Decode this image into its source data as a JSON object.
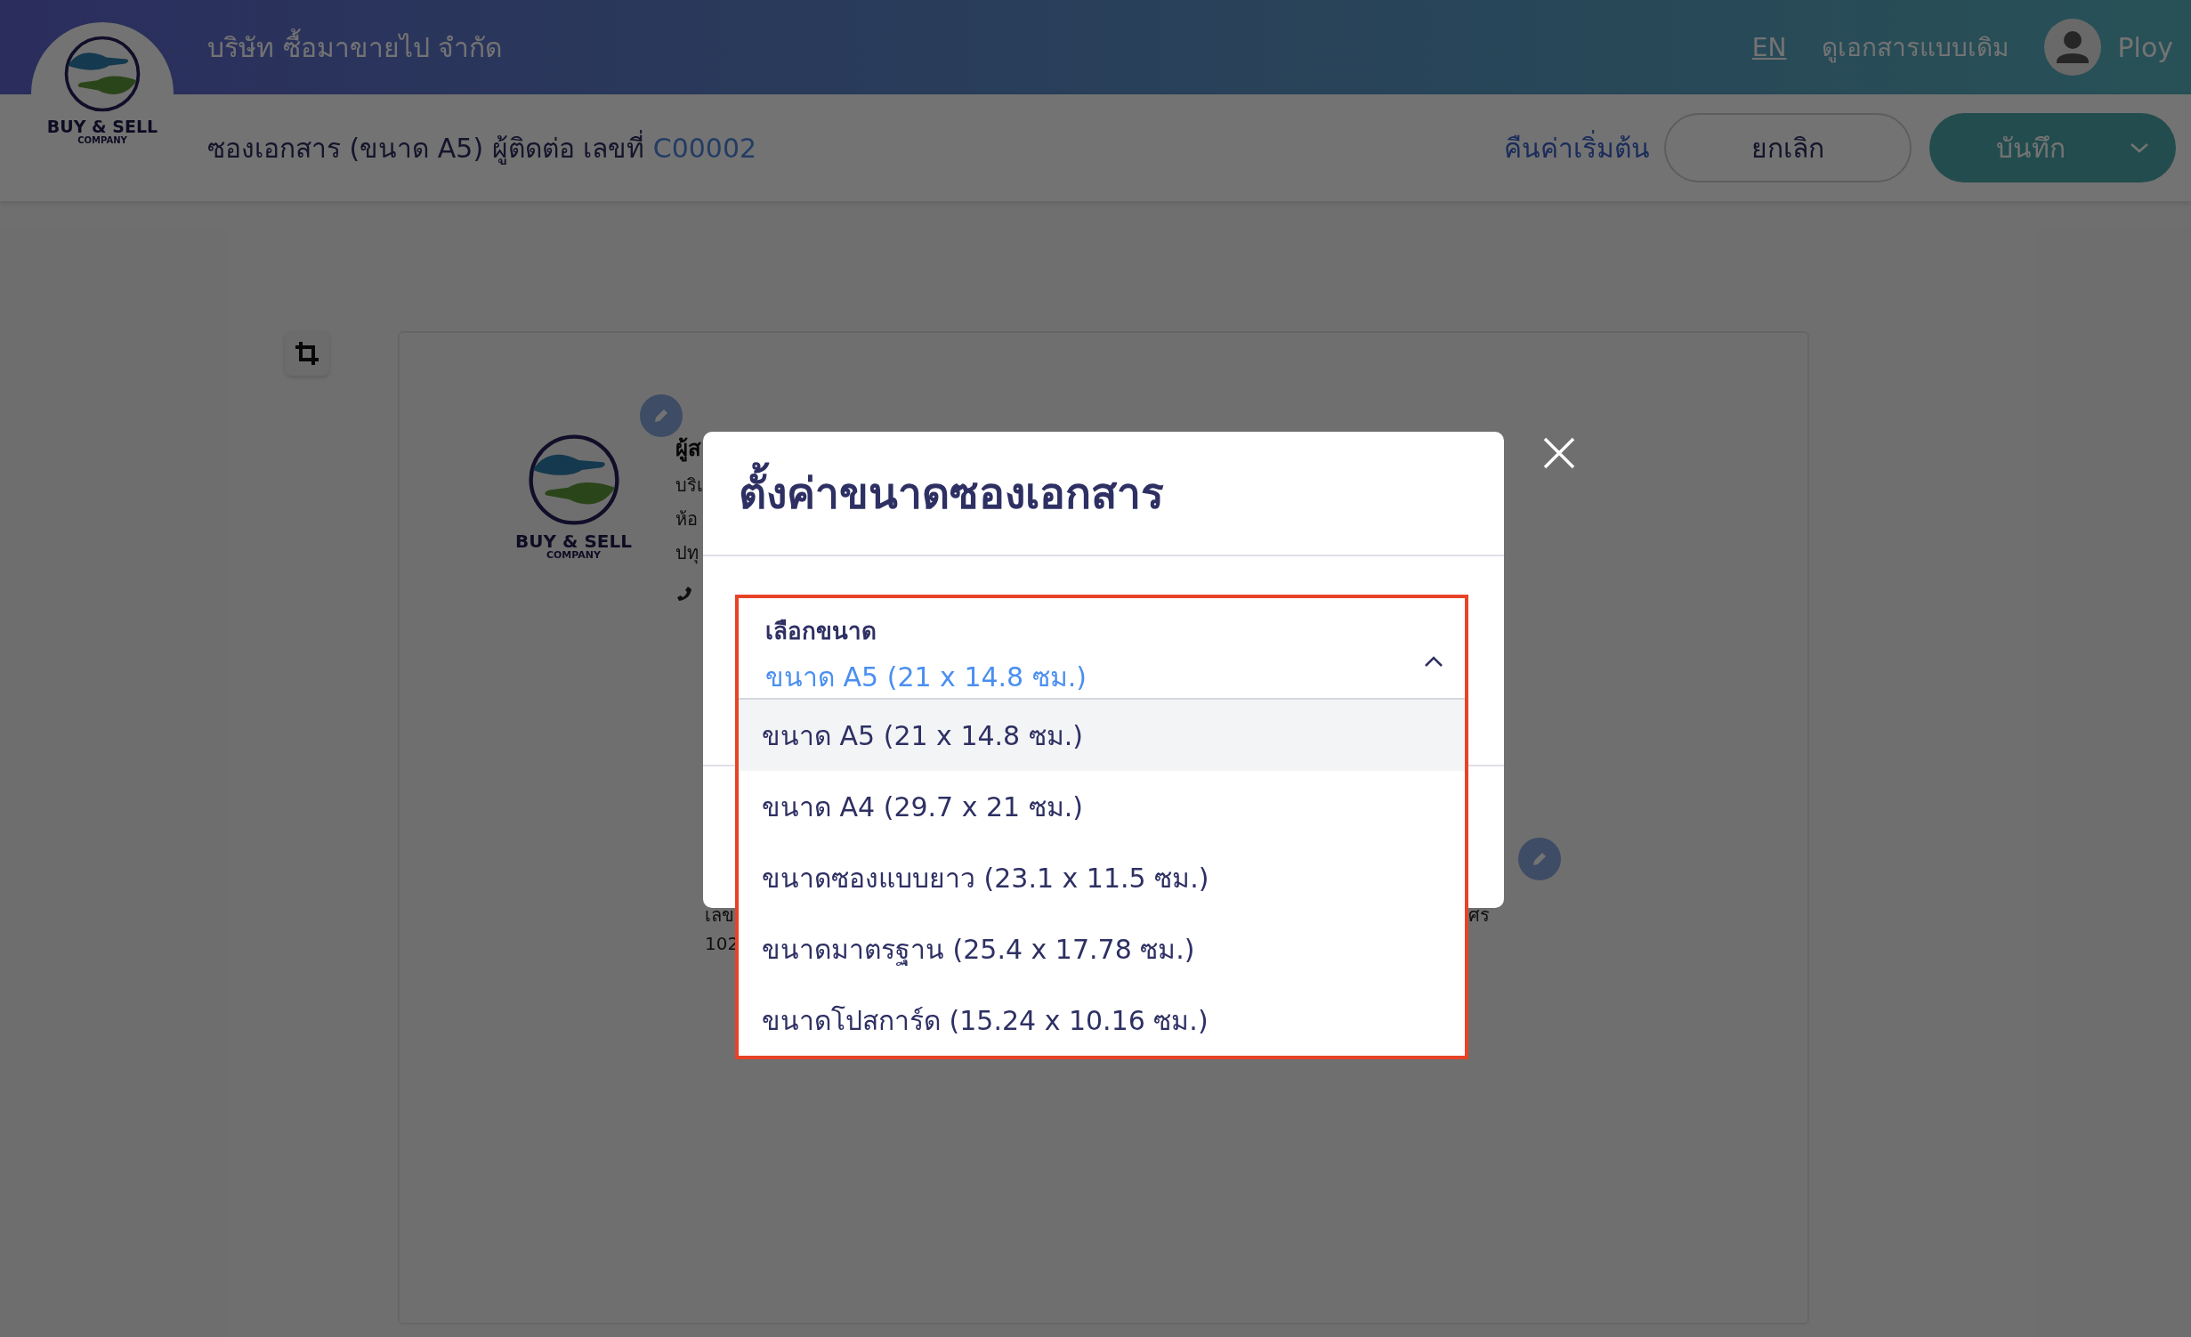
{
  "header": {
    "logo_name": "BUY & SELL",
    "logo_sub": "COMPANY",
    "company": "บริษัท ซื้อมาขายไป จำกัด",
    "language": "EN",
    "classic_view": "ดูเอกสารแบบเดิม",
    "user": "Ploy"
  },
  "toolbar": {
    "title": "ซองเอกสาร (ขนาด A5) ผู้ติดต่อ เลขที่",
    "doc_number": "C00002",
    "reset": "คืนค่าเริ่มต้น",
    "cancel": "ยกเลิก",
    "save": "บันทึก"
  },
  "document": {
    "logo_name": "BUY & SELL",
    "logo_sub": "COMPANY",
    "sender_name": "ผู้ส",
    "sender_lines": [
      "บริเ",
      "ห้อ",
      "ปทุ"
    ],
    "recipient_lines": [
      "เลข",
      "102"
    ],
    "right_fragment": "ศร"
  },
  "modal": {
    "title": "ตั้งค่าขนาดซองเอกสาร",
    "select": {
      "label": "เลือกขนาด",
      "value": "ขนาด A5 (21 x 14.8 ซม.)",
      "expanded": true,
      "options": [
        {
          "label": "ขนาด A5 (21 x 14.8 ซม.)",
          "selected": true
        },
        {
          "label": "ขนาด A4 (29.7 x 21 ซม.)",
          "selected": false
        },
        {
          "label": "ขนาดซองแบบยาว (23.1 x 11.5 ซม.)",
          "selected": false
        },
        {
          "label": "ขนาดมาตรฐาน (25.4 x 17.78 ซม.)",
          "selected": false
        },
        {
          "label": "ขนาดโปสการ์ด (15.24 x 10.16 ซม.)",
          "selected": false
        }
      ]
    }
  }
}
